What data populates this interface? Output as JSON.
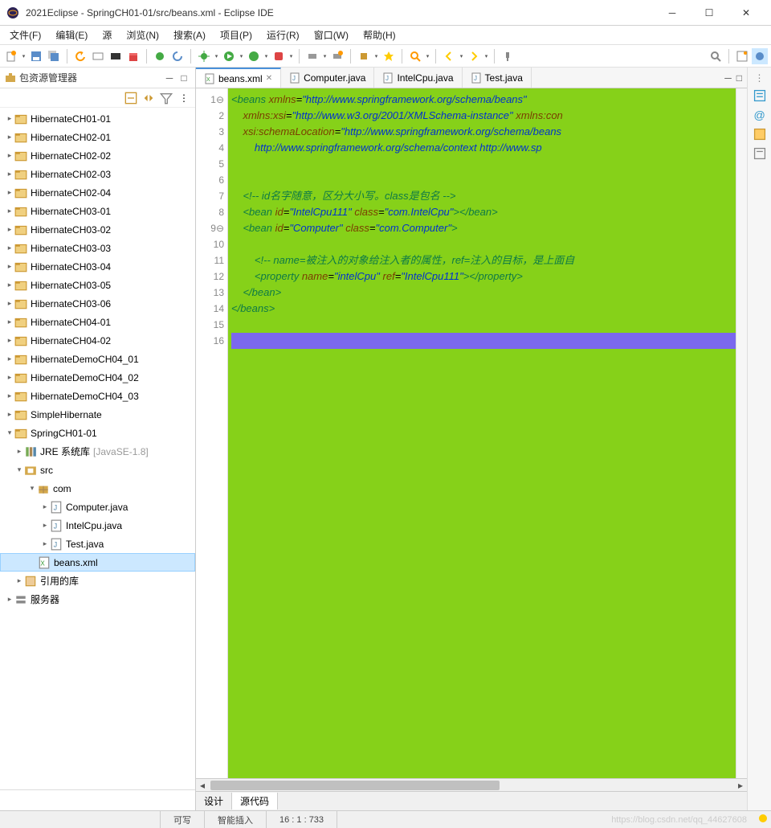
{
  "window": {
    "title": "2021Eclipse - SpringCH01-01/src/beans.xml - Eclipse IDE"
  },
  "menubar": [
    "文件(F)",
    "编辑(E)",
    "源",
    "浏览(N)",
    "搜索(A)",
    "项目(P)",
    "运行(R)",
    "窗口(W)",
    "帮助(H)"
  ],
  "panel": {
    "title": "包资源管理器"
  },
  "tree": [
    {
      "d": 0,
      "a": "▸",
      "i": "proj",
      "t": "HibernateCH01-01"
    },
    {
      "d": 0,
      "a": "▸",
      "i": "proj",
      "t": "HibernateCH02-01"
    },
    {
      "d": 0,
      "a": "▸",
      "i": "proj",
      "t": "HibernateCH02-02"
    },
    {
      "d": 0,
      "a": "▸",
      "i": "proj",
      "t": "HibernateCH02-03"
    },
    {
      "d": 0,
      "a": "▸",
      "i": "proj",
      "t": "HibernateCH02-04"
    },
    {
      "d": 0,
      "a": "▸",
      "i": "proj",
      "t": "HibernateCH03-01"
    },
    {
      "d": 0,
      "a": "▸",
      "i": "proj",
      "t": "HibernateCH03-02"
    },
    {
      "d": 0,
      "a": "▸",
      "i": "proj",
      "t": "HibernateCH03-03"
    },
    {
      "d": 0,
      "a": "▸",
      "i": "proj",
      "t": "HibernateCH03-04"
    },
    {
      "d": 0,
      "a": "▸",
      "i": "proj",
      "t": "HibernateCH03-05"
    },
    {
      "d": 0,
      "a": "▸",
      "i": "proj",
      "t": "HibernateCH03-06"
    },
    {
      "d": 0,
      "a": "▸",
      "i": "proj",
      "t": "HibernateCH04-01"
    },
    {
      "d": 0,
      "a": "▸",
      "i": "proj",
      "t": "HibernateCH04-02"
    },
    {
      "d": 0,
      "a": "▸",
      "i": "proj",
      "t": "HibernateDemoCH04_01"
    },
    {
      "d": 0,
      "a": "▸",
      "i": "proj",
      "t": "HibernateDemoCH04_02"
    },
    {
      "d": 0,
      "a": "▸",
      "i": "proj",
      "t": "HibernateDemoCH04_03"
    },
    {
      "d": 0,
      "a": "▸",
      "i": "proj",
      "t": "SimpleHibernate"
    },
    {
      "d": 0,
      "a": "▾",
      "i": "proj",
      "t": "SpringCH01-01"
    },
    {
      "d": 1,
      "a": "▸",
      "i": "lib",
      "t": "JRE 系统库",
      "dec": "[JavaSE-1.8]"
    },
    {
      "d": 1,
      "a": "▾",
      "i": "src",
      "t": "src"
    },
    {
      "d": 2,
      "a": "▾",
      "i": "pkg",
      "t": "com"
    },
    {
      "d": 3,
      "a": "▸",
      "i": "java",
      "t": "Computer.java"
    },
    {
      "d": 3,
      "a": "▸",
      "i": "java",
      "t": "IntelCpu.java"
    },
    {
      "d": 3,
      "a": "▸",
      "i": "java",
      "t": "Test.java"
    },
    {
      "d": 2,
      "a": "",
      "i": "xml",
      "t": "beans.xml",
      "sel": true
    },
    {
      "d": 1,
      "a": "▸",
      "i": "ref",
      "t": "引用的库"
    },
    {
      "d": 0,
      "a": "▸",
      "i": "srv",
      "t": "服务器"
    }
  ],
  "editor_tabs": [
    {
      "label": "beans.xml",
      "active": true,
      "icon": "xml"
    },
    {
      "label": "Computer.java",
      "icon": "java"
    },
    {
      "label": "IntelCpu.java",
      "icon": "java"
    },
    {
      "label": "Test.java",
      "icon": "java"
    }
  ],
  "code": {
    "lines": [
      {
        "n": 1,
        "h": "<span class='tag'>&lt;beans</span> <span class='attr'>xmlns</span>=<span class='val'>\"http://www.springframework.org/schema/beans\"</span>"
      },
      {
        "n": 2,
        "h": "    <span class='attr'>xmlns:xsi</span>=<span class='val'>\"http://www.w3.org/2001/XMLSchema-instance\"</span> <span class='attr'>xmlns:con</span>"
      },
      {
        "n": 3,
        "h": "    <span class='attr'>xsi:schemaLocation</span>=<span class='val'>\"http://www.springframework.org/schema/beans</span>"
      },
      {
        "n": 4,
        "h": "        <span class='val'>http://www.springframework.org/schema/context http://www.sp</span>"
      },
      {
        "n": 5,
        "h": ""
      },
      {
        "n": 6,
        "h": ""
      },
      {
        "n": 7,
        "h": "    <span class='cmt'>&lt;!-- id名字随意，区分大小写。class是包名 --&gt;</span>"
      },
      {
        "n": 8,
        "h": "    <span class='tag'>&lt;bean</span> <span class='attr'>id</span>=<span class='val'>\"IntelCpu111\"</span> <span class='attr'>class</span>=<span class='val'>\"com.IntelCpu\"</span><span class='tag'>&gt;&lt;/bean&gt;</span>"
      },
      {
        "n": 9,
        "h": "    <span class='tag'>&lt;bean</span> <span class='attr'>id</span>=<span class='val'>\"Computer\"</span> <span class='attr'>class</span>=<span class='val'>\"com.Computer\"</span><span class='tag'>&gt;</span>"
      },
      {
        "n": 10,
        "h": ""
      },
      {
        "n": 11,
        "h": "        <span class='cmt'>&lt;!-- name=被注入的对象给注入者的属性，ref=注入的目标，是上面自</span>"
      },
      {
        "n": 12,
        "h": "        <span class='tag'>&lt;property</span> <span class='attr'>name</span>=<span class='val'>\"intelCpu\"</span> <span class='attr'>ref</span>=<span class='val'>\"IntelCpu111\"</span><span class='tag'>&gt;&lt;/property&gt;</span>"
      },
      {
        "n": 13,
        "h": "    <span class='tag'>&lt;/bean&gt;</span>"
      },
      {
        "n": 14,
        "h": "<span class='tag'>&lt;/beans&gt;</span>"
      },
      {
        "n": 15,
        "h": ""
      },
      {
        "n": 16,
        "h": "",
        "cursor": true
      }
    ]
  },
  "design_tabs": [
    "设计",
    "源代码"
  ],
  "statusbar": {
    "writable": "可写",
    "insert": "智能插入",
    "position": "16 : 1 : 733",
    "watermark": "https://blog.csdn.net/qq_44627608"
  }
}
